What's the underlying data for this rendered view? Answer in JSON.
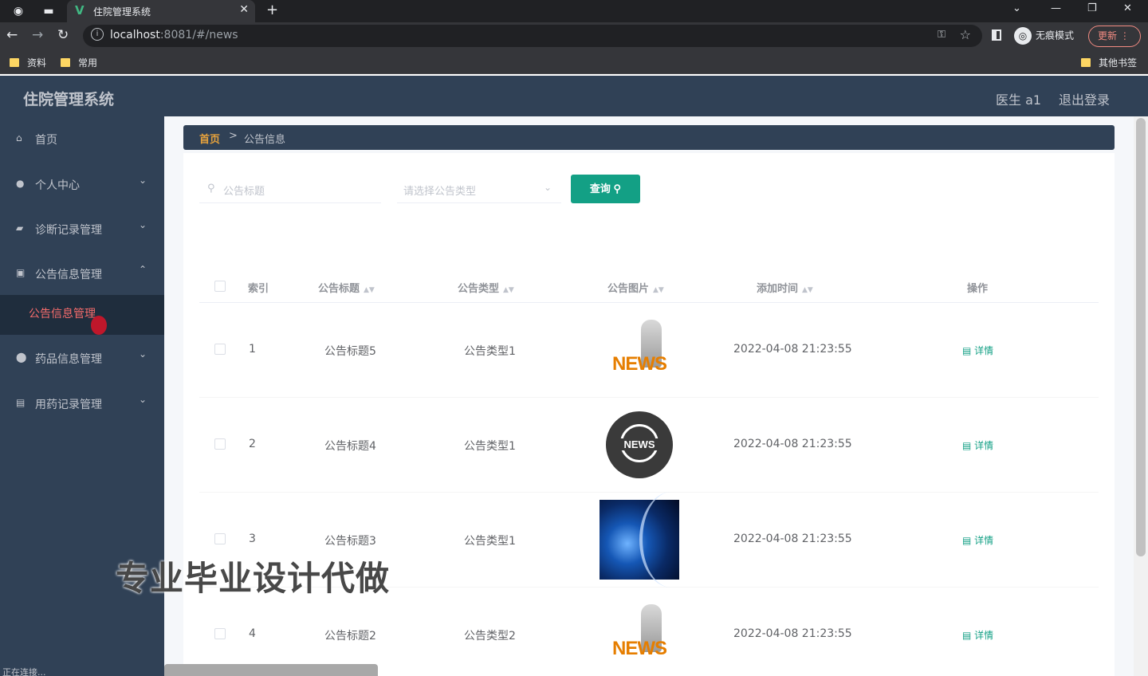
{
  "browser": {
    "tab_title": "住院管理系统",
    "url_host": "localhost",
    "url_rest": ":8081/#/news",
    "incognito_label": "无痕模式",
    "update_label": "更新",
    "bookmarks": [
      "资料",
      "常用"
    ],
    "other_bookmarks": "其他书签"
  },
  "header": {
    "app_title": "住院管理系统",
    "user": "医生 a1",
    "logout": "退出登录"
  },
  "sidebar": {
    "items": [
      {
        "label": "首页",
        "icon": "home-icon"
      },
      {
        "label": "个人中心",
        "icon": "user-icon"
      },
      {
        "label": "诊断记录管理",
        "icon": "chat-icon"
      },
      {
        "label": "公告信息管理",
        "icon": "document-icon"
      },
      {
        "label": "药品信息管理",
        "icon": "pin-icon"
      },
      {
        "label": "用药记录管理",
        "icon": "clipboard-icon"
      }
    ],
    "submenu_active": "公告信息管理",
    "status": "正在连接..."
  },
  "breadcrumb": {
    "home": "首页",
    "separator": ">",
    "current": "公告信息"
  },
  "search": {
    "title_placeholder": "公告标题",
    "type_placeholder": "请选择公告类型",
    "query_label": "查询"
  },
  "table": {
    "headers": [
      "索引",
      "公告标题",
      "公告类型",
      "公告图片",
      "添加时间",
      "操作"
    ],
    "rows": [
      {
        "index": "1",
        "title": "公告标题5",
        "type": "公告类型1",
        "image": "news-figure",
        "time": "2022-04-08 21:23:55",
        "action": "详情"
      },
      {
        "index": "2",
        "title": "公告标题4",
        "type": "公告类型1",
        "image": "news-globe-badge",
        "time": "2022-04-08 21:23:55",
        "action": "详情"
      },
      {
        "index": "3",
        "title": "公告标题3",
        "type": "公告类型1",
        "image": "blue-globe",
        "time": "2022-04-08 21:23:55",
        "action": "详情"
      },
      {
        "index": "4",
        "title": "公告标题2",
        "type": "公告类型2",
        "image": "news-figure",
        "time": "2022-04-08 21:23:55",
        "action": "详情"
      }
    ]
  },
  "image_texts": {
    "news": "NEWS"
  },
  "watermark": "专业毕业设计代做",
  "colors": {
    "sidebar_bg": "#304156",
    "accent": "#13a085",
    "active_menu": "#f56c6c",
    "breadcrumb_home": "#e6a23c"
  }
}
